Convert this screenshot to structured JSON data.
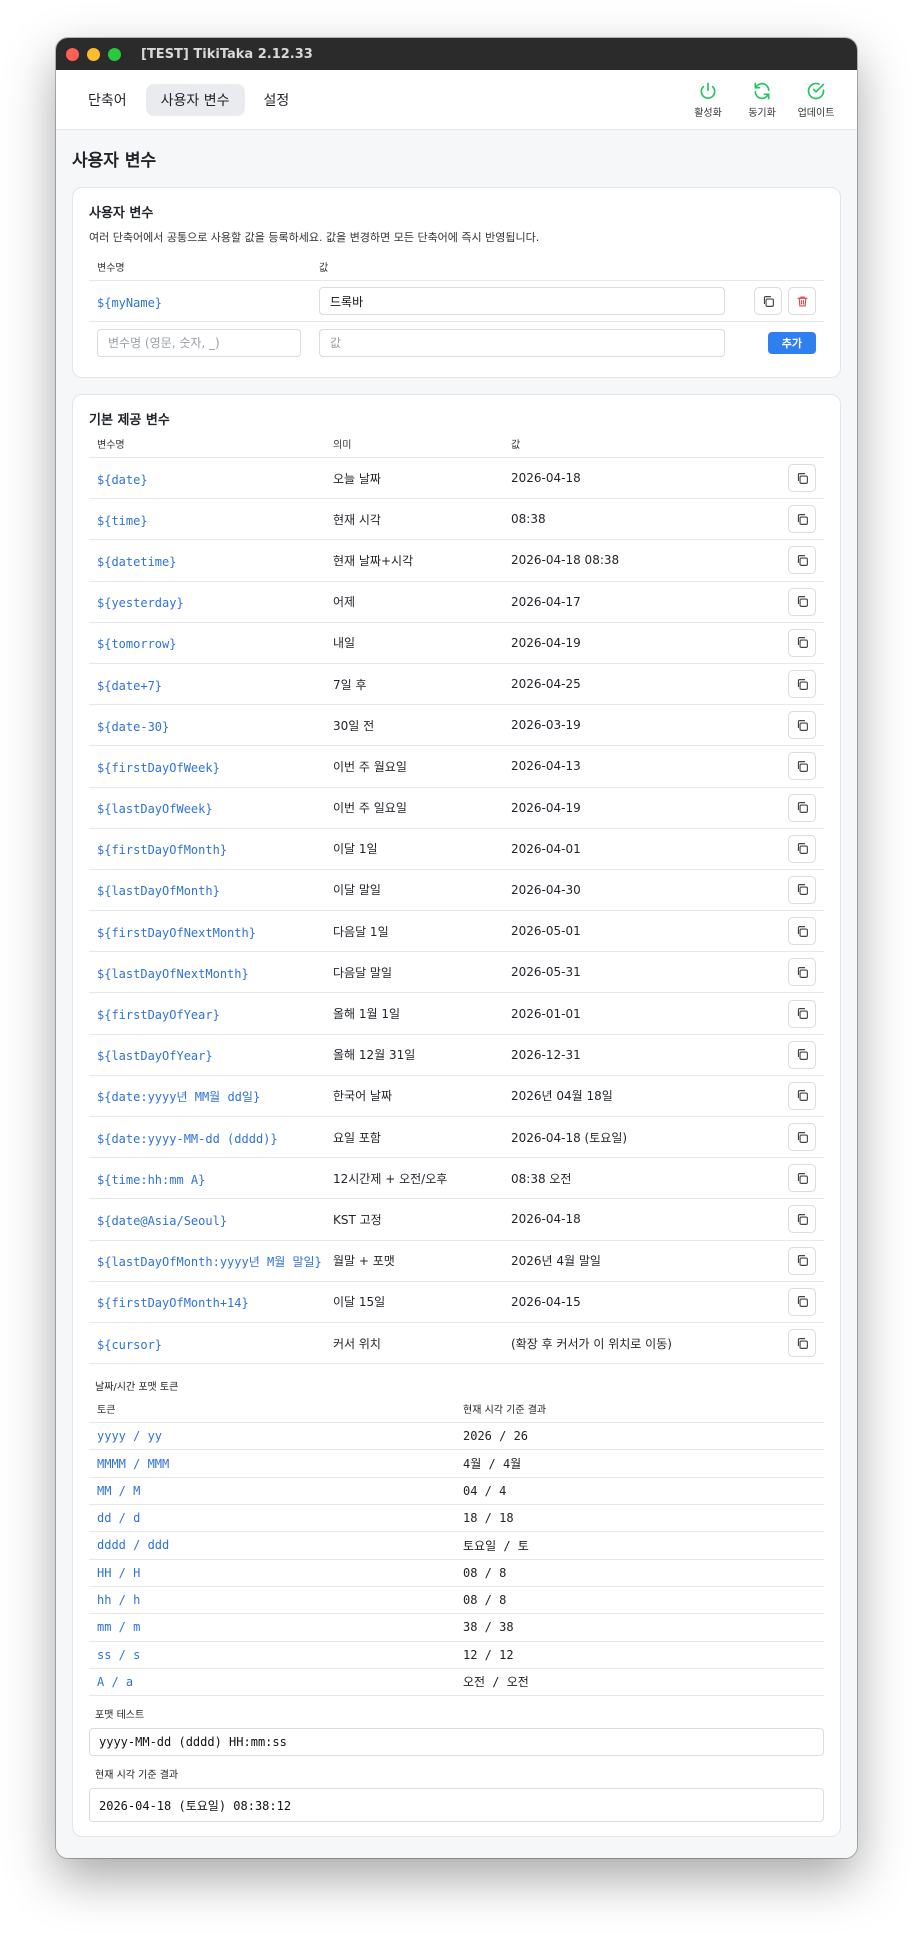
{
  "window": {
    "title": "[TEST] TikiTaka 2.12.33"
  },
  "nav": {
    "tabs": [
      {
        "label": "단축어"
      },
      {
        "label": "사용자 변수"
      },
      {
        "label": "설정"
      }
    ],
    "actions": [
      {
        "label": "활성화",
        "icon": "power-icon"
      },
      {
        "label": "동기화",
        "icon": "sync-icon"
      },
      {
        "label": "업데이트",
        "icon": "check-circle-icon"
      }
    ],
    "accent_color": "#22c55e"
  },
  "page": {
    "title": "사용자 변수"
  },
  "user_vars": {
    "title": "사용자 변수",
    "description": "여러 단축어에서 공통으로 사용할 값을 등록하세요. 값을 변경하면 모든 단축어에 즉시 반영됩니다.",
    "col_name": "변수명",
    "col_value": "값",
    "rows": [
      {
        "name": "${myName}",
        "value": "드록바"
      }
    ],
    "new_name_placeholder": "변수명 (영문, 숫자, _)",
    "new_value_placeholder": "값",
    "add_label": "추가"
  },
  "builtin": {
    "title": "기본 제공 변수",
    "col_name": "변수명",
    "col_meaning": "의미",
    "col_value": "값",
    "rows": [
      {
        "name": "${date}",
        "meaning": "오늘 날짜",
        "value": "2026-04-18"
      },
      {
        "name": "${time}",
        "meaning": "현재 시각",
        "value": "08:38"
      },
      {
        "name": "${datetime}",
        "meaning": "현재 날짜+시각",
        "value": "2026-04-18 08:38"
      },
      {
        "name": "${yesterday}",
        "meaning": "어제",
        "value": "2026-04-17"
      },
      {
        "name": "${tomorrow}",
        "meaning": "내일",
        "value": "2026-04-19"
      },
      {
        "name": "${date+7}",
        "meaning": "7일 후",
        "value": "2026-04-25"
      },
      {
        "name": "${date-30}",
        "meaning": "30일 전",
        "value": "2026-03-19"
      },
      {
        "name": "${firstDayOfWeek}",
        "meaning": "이번 주 월요일",
        "value": "2026-04-13"
      },
      {
        "name": "${lastDayOfWeek}",
        "meaning": "이번 주 일요일",
        "value": "2026-04-19"
      },
      {
        "name": "${firstDayOfMonth}",
        "meaning": "이달 1일",
        "value": "2026-04-01"
      },
      {
        "name": "${lastDayOfMonth}",
        "meaning": "이달 말일",
        "value": "2026-04-30"
      },
      {
        "name": "${firstDayOfNextMonth}",
        "meaning": "다음달 1일",
        "value": "2026-05-01"
      },
      {
        "name": "${lastDayOfNextMonth}",
        "meaning": "다음달 말일",
        "value": "2026-05-31"
      },
      {
        "name": "${firstDayOfYear}",
        "meaning": "올해 1월 1일",
        "value": "2026-01-01"
      },
      {
        "name": "${lastDayOfYear}",
        "meaning": "올해 12월 31일",
        "value": "2026-12-31"
      },
      {
        "name": "${date:yyyy년 MM월 dd일}",
        "meaning": "한국어 날짜",
        "value": "2026년 04월 18일"
      },
      {
        "name": "${date:yyyy-MM-dd (dddd)}",
        "meaning": "요일 포함",
        "value": "2026-04-18 (토요일)"
      },
      {
        "name": "${time:hh:mm A}",
        "meaning": "12시간제 + 오전/오후",
        "value": "08:38 오전"
      },
      {
        "name": "${date@Asia/Seoul}",
        "meaning": "KST 고정",
        "value": "2026-04-18"
      },
      {
        "name": "${lastDayOfMonth:yyyy년 M월 말일}",
        "meaning": "월말 + 포맷",
        "value": "2026년 4월 말일"
      },
      {
        "name": "${firstDayOfMonth+14}",
        "meaning": "이달 15일",
        "value": "2026-04-15"
      },
      {
        "name": "${cursor}",
        "meaning": "커서 위치",
        "value": "(확장 후 커서가 이 위치로 이동)"
      }
    ]
  },
  "tokens": {
    "label": "날짜/시간 포맷 토큰",
    "col_token": "토큰",
    "col_result": "현재 시각 기준 결과",
    "rows": [
      {
        "token": "yyyy / yy",
        "result": "2026 / 26"
      },
      {
        "token": "MMMM / MMM",
        "result": "4월 / 4월"
      },
      {
        "token": "MM / M",
        "result": "04 / 4"
      },
      {
        "token": "dd / d",
        "result": "18 / 18"
      },
      {
        "token": "dddd / ddd",
        "result": "토요일 / 토"
      },
      {
        "token": "HH / H",
        "result": "08 / 8"
      },
      {
        "token": "hh / h",
        "result": "08 / 8"
      },
      {
        "token": "mm / m",
        "result": "38 / 38"
      },
      {
        "token": "ss / s",
        "result": "12 / 12"
      },
      {
        "token": "A / a",
        "result": "오전 / 오전"
      }
    ]
  },
  "format_test": {
    "label": "포맷 테스트",
    "value": "yyyy-MM-dd (dddd) HH:mm:ss",
    "result_label": "현재 시각 기준 결과",
    "result": "2026-04-18 (토요일) 08:38:12"
  }
}
